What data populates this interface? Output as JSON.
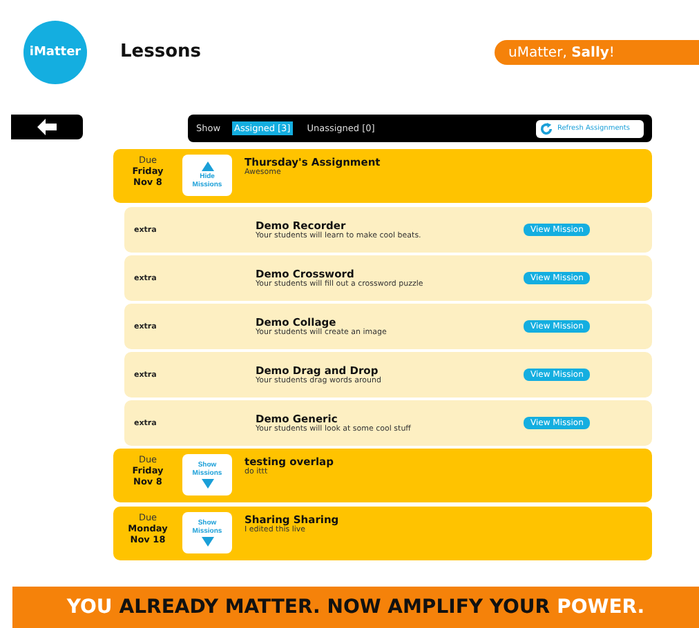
{
  "logo": {
    "text": "iMatter"
  },
  "page_title": "Lessons",
  "greeting": "uMatter, **Sally**!",
  "filter_bar": {
    "label": "Show",
    "tabs": [
      {
        "label": "Assigned [3]",
        "selected": true
      },
      {
        "label": "Unassigned [0]",
        "selected": false
      }
    ],
    "refresh_button": "Refresh Assignments"
  },
  "assignments": [
    {
      "due_label": "Due",
      "due_day": "Friday",
      "due_date": "Nov 8",
      "toggle_label": "Hide Missions",
      "expanded": true,
      "title": "Thursday's Assignment",
      "description": "Awesome",
      "missions": [
        {
          "tag": "extra",
          "title": "Demo Recorder",
          "description": "Your students will learn to make cool beats.",
          "button": "View Mission"
        },
        {
          "tag": "extra",
          "title": "Demo Crossword",
          "description": "Your students will fill out a crossword puzzle",
          "button": "View Mission"
        },
        {
          "tag": "extra",
          "title": "Demo Collage",
          "description": "Your students will create an image",
          "button": "View Mission"
        },
        {
          "tag": "extra",
          "title": "Demo Drag and Drop",
          "description": "Your students drag words around",
          "button": "View Mission"
        },
        {
          "tag": "extra",
          "title": "Demo Generic",
          "description": "Your students will look at some cool stuff",
          "button": "View Mission"
        }
      ]
    },
    {
      "due_label": "Due",
      "due_day": "Friday",
      "due_date": "Nov 8",
      "toggle_label": "Show Missions",
      "expanded": false,
      "title": "testing overlap",
      "description": "do ittt"
    },
    {
      "due_label": "Due",
      "due_day": "Monday",
      "due_date": "Nov 18",
      "toggle_label": "Show Missions",
      "expanded": false,
      "title": "Sharing Sharing",
      "description": "I edited this live"
    }
  ],
  "footer": {
    "segments": [
      {
        "text": "YOU",
        "highlight": true
      },
      {
        "text": "ALREADY MATTER. NOW AMPLIFY YOUR",
        "highlight": false
      },
      {
        "text": "POWER.",
        "highlight": true
      }
    ]
  }
}
